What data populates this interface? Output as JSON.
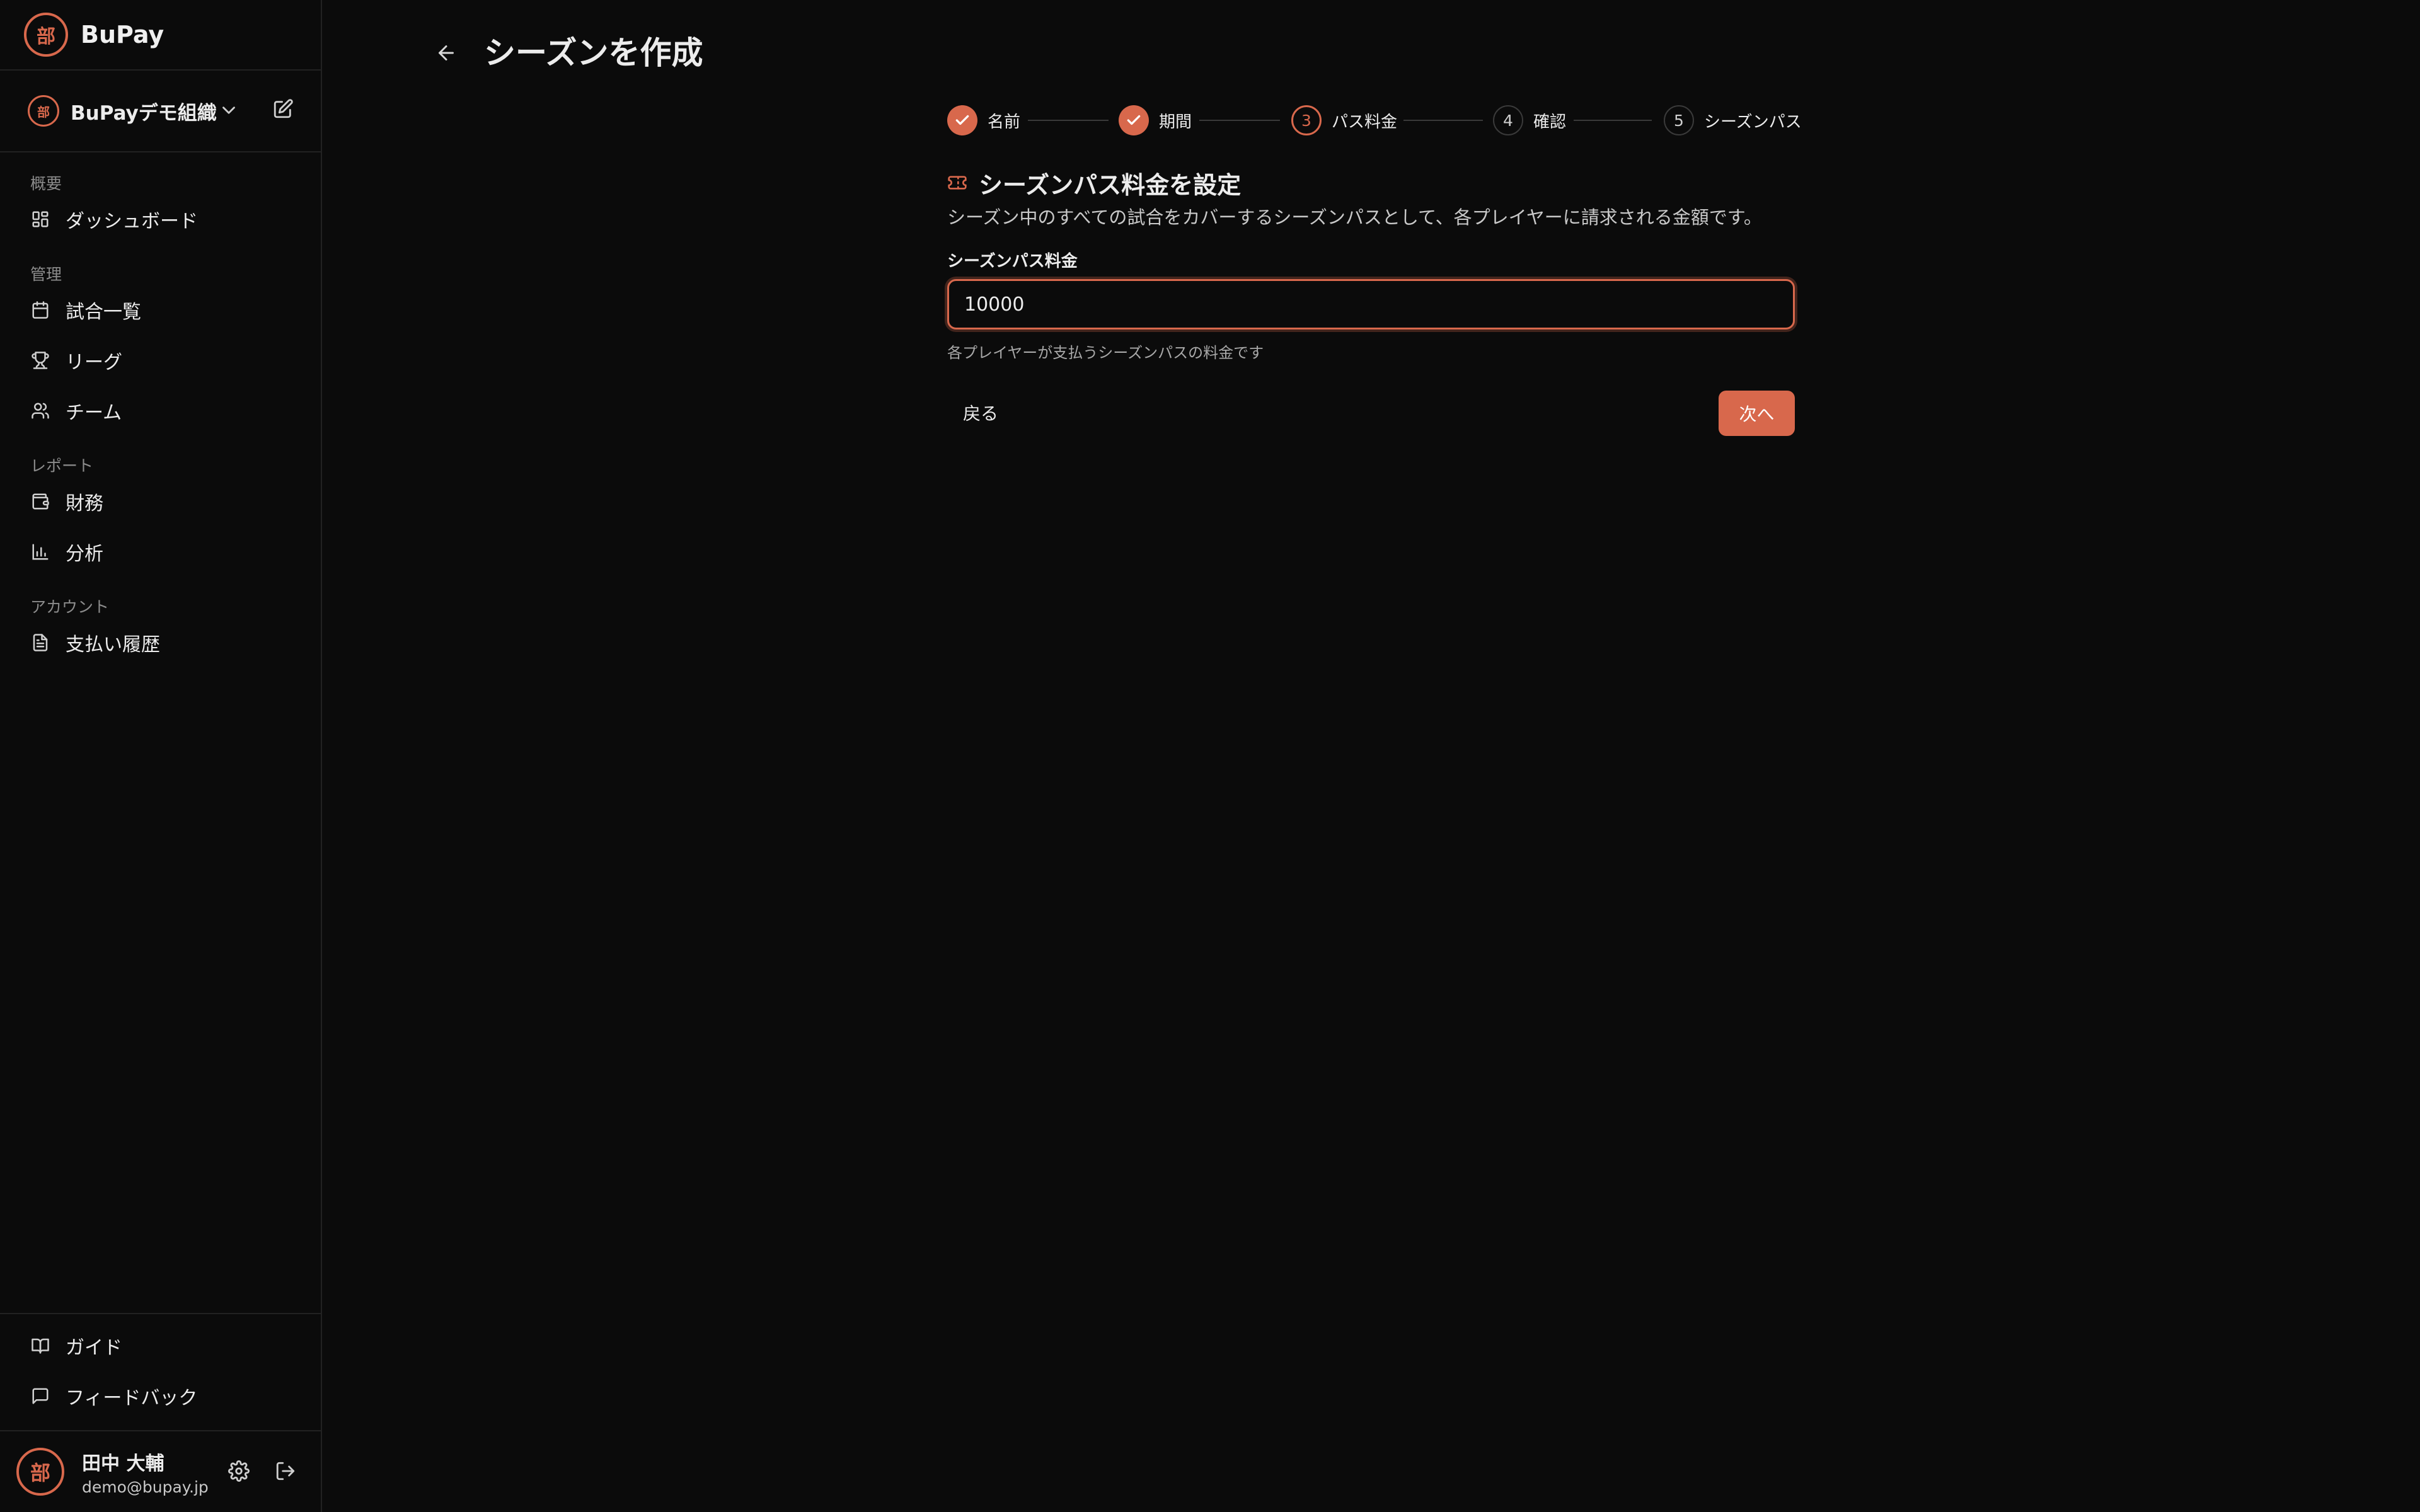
{
  "app": {
    "name": "BuPay",
    "logo_glyph": "部"
  },
  "colors": {
    "accent": "#d8684c",
    "background": "#0b0b0b",
    "border": "#222222"
  },
  "sidebar": {
    "org": {
      "name": "BuPayデモ組織",
      "chevron_icon": "chevron-down-icon",
      "edit_icon": "edit-icon"
    },
    "sections": [
      {
        "label": "概要",
        "items": [
          {
            "label": "ダッシュボード",
            "icon": "dashboard-icon"
          }
        ]
      },
      {
        "label": "管理",
        "items": [
          {
            "label": "試合一覧",
            "icon": "calendar-icon"
          },
          {
            "label": "リーグ",
            "icon": "trophy-icon"
          },
          {
            "label": "チーム",
            "icon": "users-icon"
          }
        ]
      },
      {
        "label": "レポート",
        "items": [
          {
            "label": "財務",
            "icon": "wallet-icon"
          },
          {
            "label": "分析",
            "icon": "bar-chart-icon"
          }
        ]
      },
      {
        "label": "アカウント",
        "items": [
          {
            "label": "支払い履歴",
            "icon": "document-icon"
          }
        ]
      }
    ],
    "footer_items": [
      {
        "label": "ガイド",
        "icon": "book-icon"
      },
      {
        "label": "フィードバック",
        "icon": "message-icon"
      }
    ],
    "user": {
      "name": "田中 大輔",
      "email": "demo@bupay.jp"
    }
  },
  "header": {
    "title": "シーズンを作成"
  },
  "stepper": {
    "current": 3,
    "steps": [
      {
        "number": "1",
        "label": "名前",
        "status": "done"
      },
      {
        "number": "2",
        "label": "期間",
        "status": "done"
      },
      {
        "number": "3",
        "label": "パス料金",
        "status": "active"
      },
      {
        "number": "4",
        "label": "確認",
        "status": "pending"
      },
      {
        "number": "5",
        "label": "シーズンパス",
        "status": "pending"
      }
    ]
  },
  "form": {
    "title": "シーズンパス料金を設定",
    "description": "シーズン中のすべての試合をカバーするシーズンパスとして、各プレイヤーに請求される金額です。",
    "field_label": "シーズンパス料金",
    "value": "10000",
    "help": "各プレイヤーが支払うシーズンパスの料金です",
    "back_label": "戻る",
    "next_label": "次へ"
  }
}
